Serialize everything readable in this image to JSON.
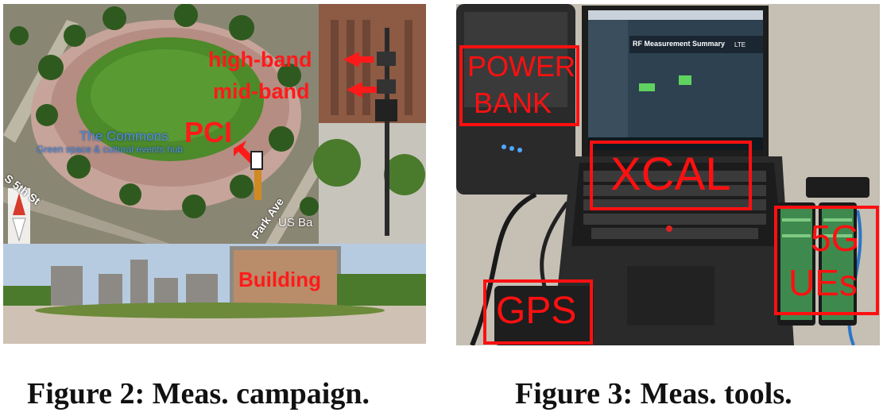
{
  "figure2": {
    "labels": {
      "high_band": "high-band",
      "mid_band": "mid-band",
      "pci": "PCI",
      "commons": "The Commons",
      "commons_sub": "Green space & cultural events hub",
      "street_5th": "S 5th St",
      "park_ave": "Park Ave",
      "us_bank": "US Ba",
      "building": "Building"
    },
    "caption": "Figure 2: Meas. campaign."
  },
  "figure3": {
    "boxes": {
      "power_bank": [
        "POWER",
        "BANK"
      ],
      "xcal": "XCAL",
      "gps": "GPS",
      "ues": [
        "5G",
        "UEs"
      ]
    },
    "screen": {
      "window_title": "RF Measurement Summary",
      "state": "LTE"
    },
    "caption": "Figure 3: Meas. tools."
  },
  "colors": {
    "annotation_red": "#ff1a1a",
    "commons_label": "#4f8fe0"
  }
}
